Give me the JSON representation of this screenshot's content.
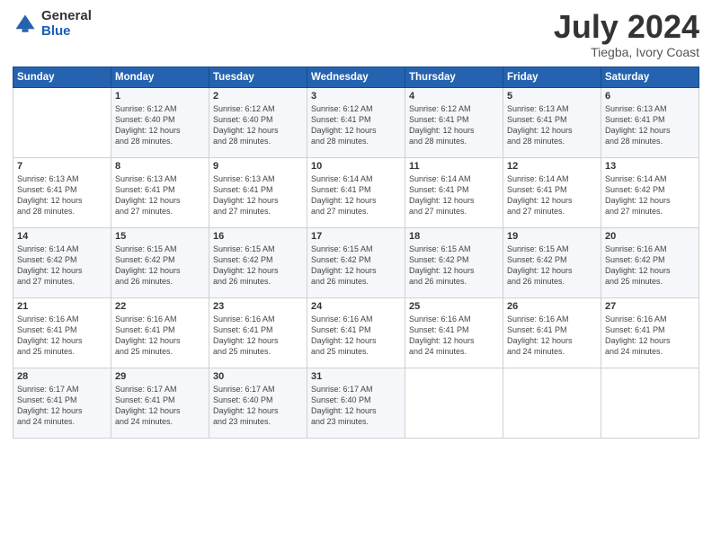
{
  "logo": {
    "general": "General",
    "blue": "Blue"
  },
  "title": "July 2024",
  "subtitle": "Tiegba, Ivory Coast",
  "headers": [
    "Sunday",
    "Monday",
    "Tuesday",
    "Wednesday",
    "Thursday",
    "Friday",
    "Saturday"
  ],
  "weeks": [
    [
      {
        "num": "",
        "info": ""
      },
      {
        "num": "1",
        "info": "Sunrise: 6:12 AM\nSunset: 6:40 PM\nDaylight: 12 hours\nand 28 minutes."
      },
      {
        "num": "2",
        "info": "Sunrise: 6:12 AM\nSunset: 6:40 PM\nDaylight: 12 hours\nand 28 minutes."
      },
      {
        "num": "3",
        "info": "Sunrise: 6:12 AM\nSunset: 6:41 PM\nDaylight: 12 hours\nand 28 minutes."
      },
      {
        "num": "4",
        "info": "Sunrise: 6:12 AM\nSunset: 6:41 PM\nDaylight: 12 hours\nand 28 minutes."
      },
      {
        "num": "5",
        "info": "Sunrise: 6:13 AM\nSunset: 6:41 PM\nDaylight: 12 hours\nand 28 minutes."
      },
      {
        "num": "6",
        "info": "Sunrise: 6:13 AM\nSunset: 6:41 PM\nDaylight: 12 hours\nand 28 minutes."
      }
    ],
    [
      {
        "num": "7",
        "info": "Sunrise: 6:13 AM\nSunset: 6:41 PM\nDaylight: 12 hours\nand 28 minutes."
      },
      {
        "num": "8",
        "info": "Sunrise: 6:13 AM\nSunset: 6:41 PM\nDaylight: 12 hours\nand 27 minutes."
      },
      {
        "num": "9",
        "info": "Sunrise: 6:13 AM\nSunset: 6:41 PM\nDaylight: 12 hours\nand 27 minutes."
      },
      {
        "num": "10",
        "info": "Sunrise: 6:14 AM\nSunset: 6:41 PM\nDaylight: 12 hours\nand 27 minutes."
      },
      {
        "num": "11",
        "info": "Sunrise: 6:14 AM\nSunset: 6:41 PM\nDaylight: 12 hours\nand 27 minutes."
      },
      {
        "num": "12",
        "info": "Sunrise: 6:14 AM\nSunset: 6:41 PM\nDaylight: 12 hours\nand 27 minutes."
      },
      {
        "num": "13",
        "info": "Sunrise: 6:14 AM\nSunset: 6:42 PM\nDaylight: 12 hours\nand 27 minutes."
      }
    ],
    [
      {
        "num": "14",
        "info": "Sunrise: 6:14 AM\nSunset: 6:42 PM\nDaylight: 12 hours\nand 27 minutes."
      },
      {
        "num": "15",
        "info": "Sunrise: 6:15 AM\nSunset: 6:42 PM\nDaylight: 12 hours\nand 26 minutes."
      },
      {
        "num": "16",
        "info": "Sunrise: 6:15 AM\nSunset: 6:42 PM\nDaylight: 12 hours\nand 26 minutes."
      },
      {
        "num": "17",
        "info": "Sunrise: 6:15 AM\nSunset: 6:42 PM\nDaylight: 12 hours\nand 26 minutes."
      },
      {
        "num": "18",
        "info": "Sunrise: 6:15 AM\nSunset: 6:42 PM\nDaylight: 12 hours\nand 26 minutes."
      },
      {
        "num": "19",
        "info": "Sunrise: 6:15 AM\nSunset: 6:42 PM\nDaylight: 12 hours\nand 26 minutes."
      },
      {
        "num": "20",
        "info": "Sunrise: 6:16 AM\nSunset: 6:42 PM\nDaylight: 12 hours\nand 25 minutes."
      }
    ],
    [
      {
        "num": "21",
        "info": "Sunrise: 6:16 AM\nSunset: 6:41 PM\nDaylight: 12 hours\nand 25 minutes."
      },
      {
        "num": "22",
        "info": "Sunrise: 6:16 AM\nSunset: 6:41 PM\nDaylight: 12 hours\nand 25 minutes."
      },
      {
        "num": "23",
        "info": "Sunrise: 6:16 AM\nSunset: 6:41 PM\nDaylight: 12 hours\nand 25 minutes."
      },
      {
        "num": "24",
        "info": "Sunrise: 6:16 AM\nSunset: 6:41 PM\nDaylight: 12 hours\nand 25 minutes."
      },
      {
        "num": "25",
        "info": "Sunrise: 6:16 AM\nSunset: 6:41 PM\nDaylight: 12 hours\nand 24 minutes."
      },
      {
        "num": "26",
        "info": "Sunrise: 6:16 AM\nSunset: 6:41 PM\nDaylight: 12 hours\nand 24 minutes."
      },
      {
        "num": "27",
        "info": "Sunrise: 6:16 AM\nSunset: 6:41 PM\nDaylight: 12 hours\nand 24 minutes."
      }
    ],
    [
      {
        "num": "28",
        "info": "Sunrise: 6:17 AM\nSunset: 6:41 PM\nDaylight: 12 hours\nand 24 minutes."
      },
      {
        "num": "29",
        "info": "Sunrise: 6:17 AM\nSunset: 6:41 PM\nDaylight: 12 hours\nand 24 minutes."
      },
      {
        "num": "30",
        "info": "Sunrise: 6:17 AM\nSunset: 6:40 PM\nDaylight: 12 hours\nand 23 minutes."
      },
      {
        "num": "31",
        "info": "Sunrise: 6:17 AM\nSunset: 6:40 PM\nDaylight: 12 hours\nand 23 minutes."
      },
      {
        "num": "",
        "info": ""
      },
      {
        "num": "",
        "info": ""
      },
      {
        "num": "",
        "info": ""
      }
    ]
  ]
}
